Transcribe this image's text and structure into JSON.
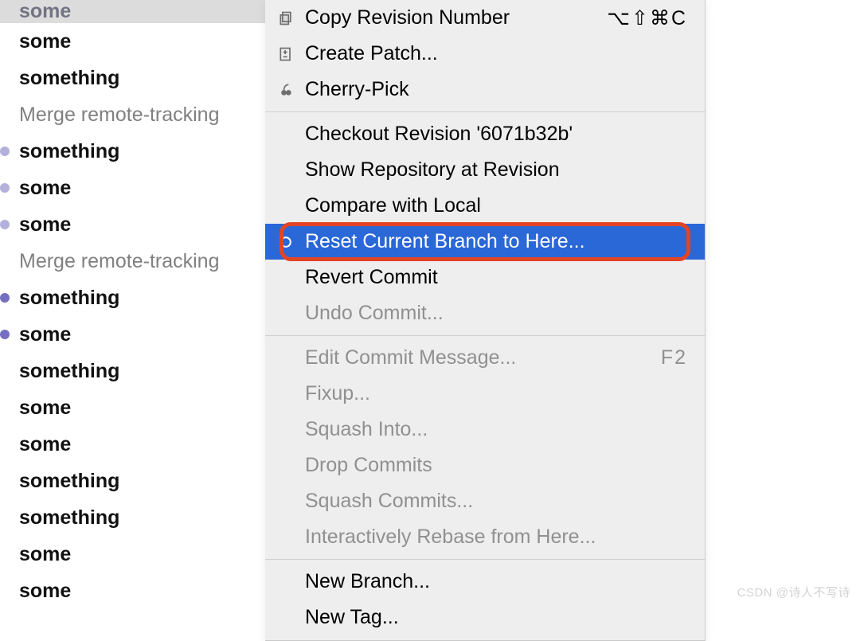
{
  "colors": {
    "headerBg": "#dcdcdc",
    "menuBg": "#eeeeee",
    "highlightBg": "#2a67d7",
    "ringColor": "#e24426",
    "graphPurple": "#746fc0"
  },
  "log": {
    "header": "some",
    "items": [
      {
        "label": "some",
        "style": "bold"
      },
      {
        "label": "something",
        "style": "bold"
      },
      {
        "label": "Merge remote-tracking",
        "style": "merge"
      },
      {
        "label": "something",
        "style": "normal",
        "dot": true
      },
      {
        "label": "some",
        "style": "normal",
        "dot": true
      },
      {
        "label": "some",
        "style": "normal",
        "dot": true
      },
      {
        "label": "Merge remote-tracking",
        "style": "merge"
      },
      {
        "label": "something",
        "style": "normal",
        "dot": true
      },
      {
        "label": "some",
        "style": "normal",
        "dot": true
      },
      {
        "label": "something",
        "style": "bold"
      },
      {
        "label": "some",
        "style": "bold"
      },
      {
        "label": "some",
        "style": "bold"
      },
      {
        "label": "something",
        "style": "bold"
      },
      {
        "label": "something",
        "style": "bold"
      },
      {
        "label": "some",
        "style": "bold"
      },
      {
        "label": "some",
        "style": "bold"
      }
    ]
  },
  "menu": {
    "items": [
      {
        "label": "Copy Revision Number",
        "icon": "copy-icon",
        "shortcut": "⌥⇧⌘C"
      },
      {
        "label": "Create Patch...",
        "icon": "patch-icon"
      },
      {
        "label": "Cherry-Pick",
        "icon": "cherry-icon"
      },
      {
        "sep": true
      },
      {
        "label": "Checkout Revision '6071b32b'"
      },
      {
        "label": "Show Repository at Revision"
      },
      {
        "label": "Compare with Local"
      },
      {
        "label": "Reset Current Branch to Here...",
        "icon": "reset-icon",
        "highlighted": true,
        "ring": true
      },
      {
        "label": "Revert Commit"
      },
      {
        "label": "Undo Commit...",
        "disabled": true
      },
      {
        "sep": true
      },
      {
        "label": "Edit Commit Message...",
        "disabled": true,
        "shortcut": "F2"
      },
      {
        "label": "Fixup...",
        "disabled": true
      },
      {
        "label": "Squash Into...",
        "disabled": true
      },
      {
        "label": "Drop Commits",
        "disabled": true
      },
      {
        "label": "Squash Commits...",
        "disabled": true
      },
      {
        "label": "Interactively Rebase from Here...",
        "disabled": true
      },
      {
        "sep": true
      },
      {
        "label": "New Branch..."
      },
      {
        "label": "New Tag..."
      }
    ]
  },
  "watermark": "CSDN @诗人不写诗"
}
